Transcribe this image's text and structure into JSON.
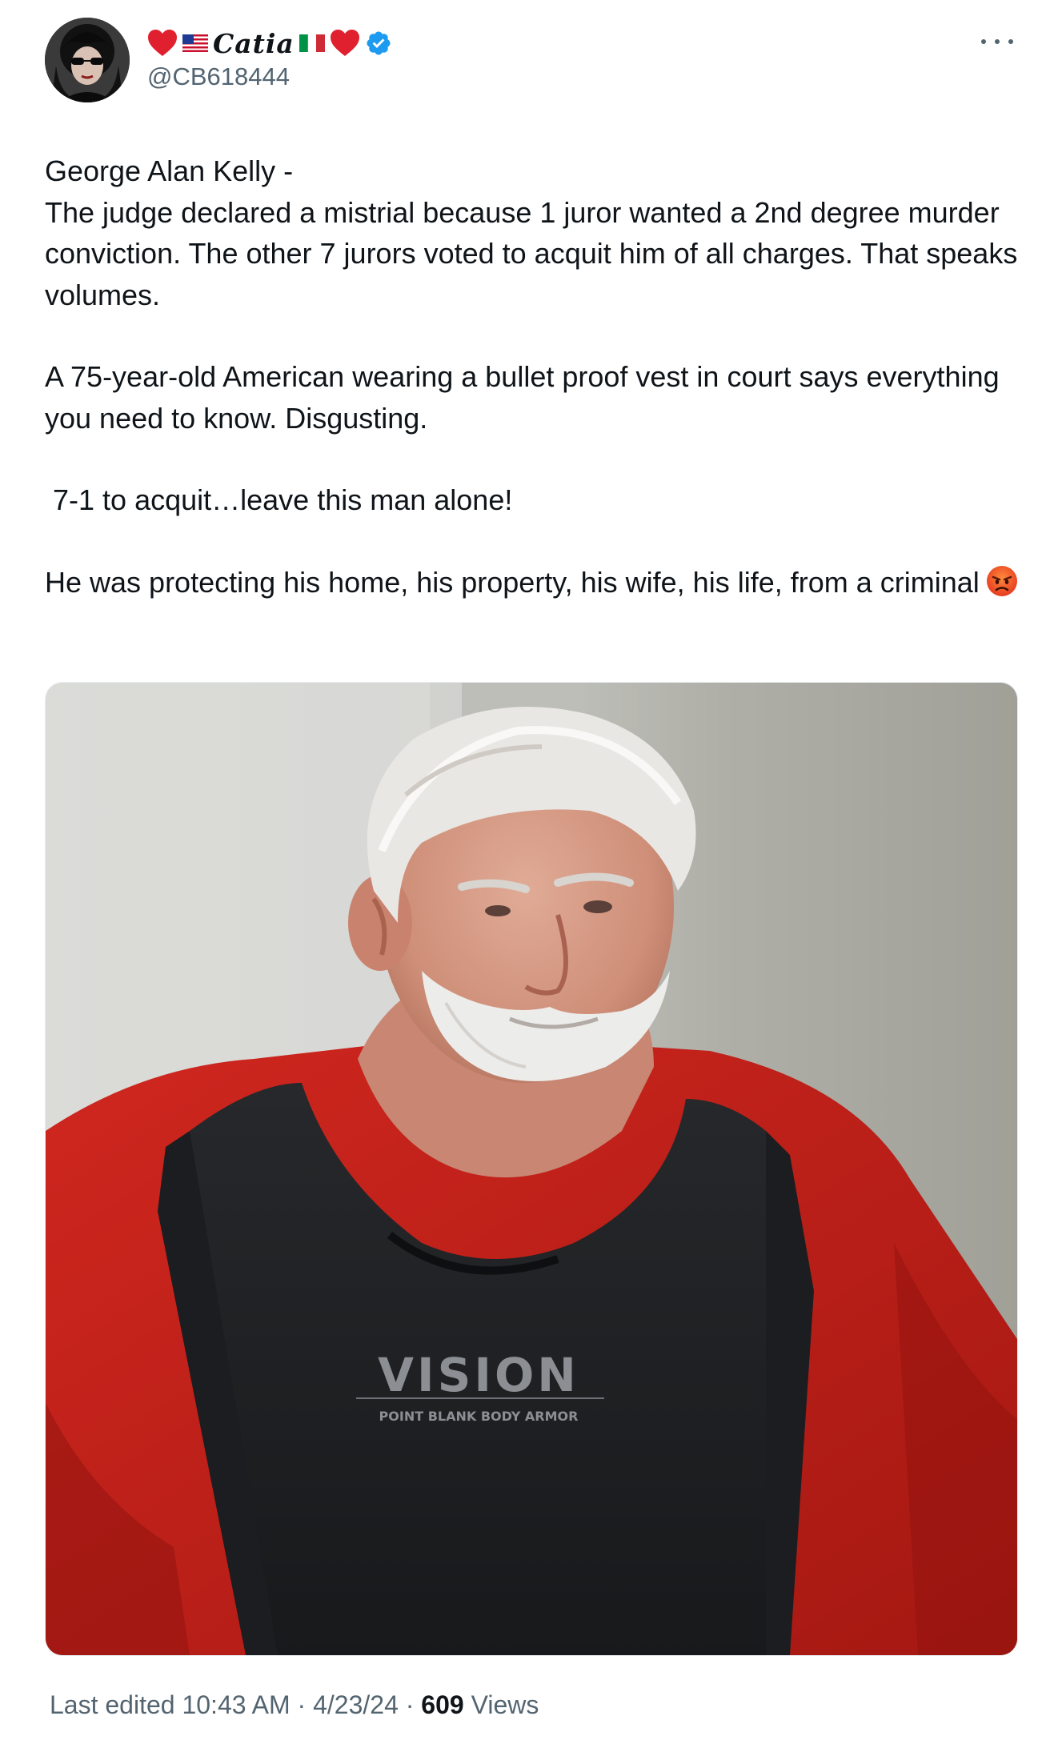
{
  "author": {
    "display_name": "Catia",
    "handle": "@CB618444",
    "verified": true,
    "badge_color": "#1d9bf0"
  },
  "tweet": {
    "paragraphs": [
      "George Alan Kelly -\nThe judge declared a mistrial because 1 juror wanted a 2nd degree murder conviction. The other 7 jurors voted to acquit him of all charges. That speaks volumes.",
      "A 75-year-old American wearing a bullet proof vest in court says everything you need to know. Disgusting.",
      " 7-1 to acquit…leave this man alone!",
      "He was protecting his home, his property, his wife, his life, from a criminal"
    ],
    "trailing_emoji": "angry-face-icon"
  },
  "media": {
    "vest_brand": "VISION",
    "vest_subtitle": "POINT BLANK BODY ARMOR"
  },
  "footer": {
    "edited_label": "Last edited",
    "time": "10:43 AM",
    "date": "4/23/24",
    "views_count": "609",
    "views_label": "Views"
  },
  "icons": {
    "heart": "heart-icon",
    "us_flag": "us-flag-icon",
    "italy_flag": "italy-flag-icon",
    "verified": "verified-badge-icon",
    "more": "more-icon"
  },
  "colors": {
    "text": "#0f1419",
    "secondary": "#536471",
    "heart": "#e0202e"
  }
}
